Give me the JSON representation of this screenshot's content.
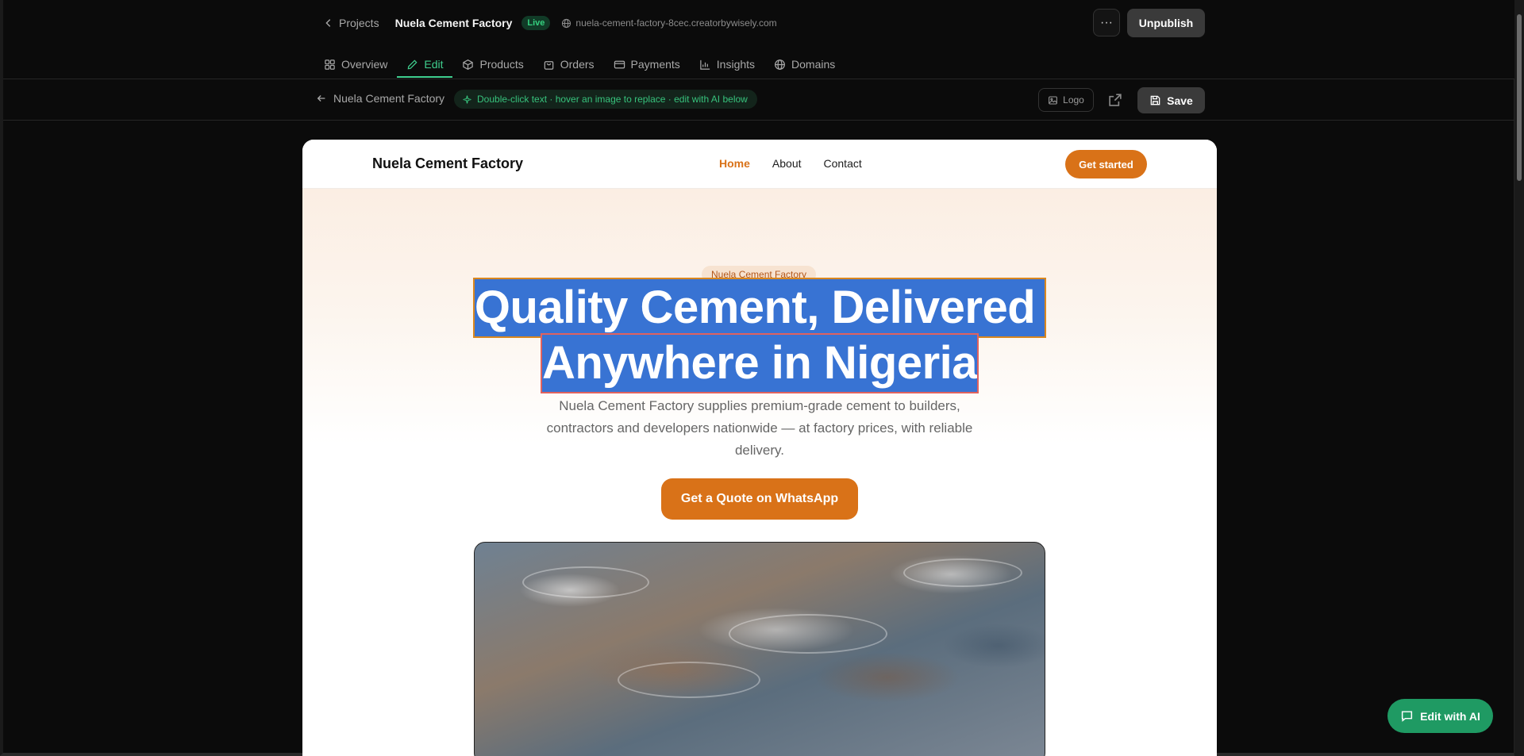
{
  "header": {
    "back_label": "Projects",
    "project_name": "Nuela Cement Factory",
    "status_badge": "Live",
    "site_url": "nuela-cement-factory-8cec.creatorbywisely.com",
    "more_label": "···",
    "unpublish_label": "Unpublish"
  },
  "tabs": [
    {
      "label": "Overview",
      "icon": "grid-icon",
      "active": false
    },
    {
      "label": "Edit",
      "icon": "pencil-icon",
      "active": true
    },
    {
      "label": "Products",
      "icon": "box-icon",
      "active": false
    },
    {
      "label": "Orders",
      "icon": "bag-icon",
      "active": false
    },
    {
      "label": "Payments",
      "icon": "card-icon",
      "active": false
    },
    {
      "label": "Insights",
      "icon": "bar-chart-icon",
      "active": false
    },
    {
      "label": "Domains",
      "icon": "globe-icon",
      "active": false
    }
  ],
  "editor": {
    "back_label": "Nuela Cement Factory",
    "hint": "Double-click text · hover an image to replace · edit with AI below",
    "logo_label": "Logo",
    "save_label": "Save"
  },
  "site": {
    "brand": "Nuela Cement Factory",
    "nav": [
      {
        "label": "Home",
        "active": true
      },
      {
        "label": "About",
        "active": false
      },
      {
        "label": "Contact",
        "active": false
      }
    ],
    "get_started_label": "Get started",
    "eyebrow": "Nuela Cement Factory",
    "headline_line1": "Quality Cement, Delivered",
    "headline_line2": "Anywhere in Nigeria",
    "subcopy": "Nuela Cement Factory supplies premium-grade cement to builders, contractors and developers nationwide — at factory prices, with reliable delivery.",
    "cta_label": "Get a Quote on WhatsApp"
  },
  "floating": {
    "edit_ai_label": "Edit with AI"
  },
  "colors": {
    "accent_green": "#3fcf8e",
    "brand_orange": "#d97218",
    "selection_blue": "#3873d3",
    "background": "#0b0b0b"
  }
}
